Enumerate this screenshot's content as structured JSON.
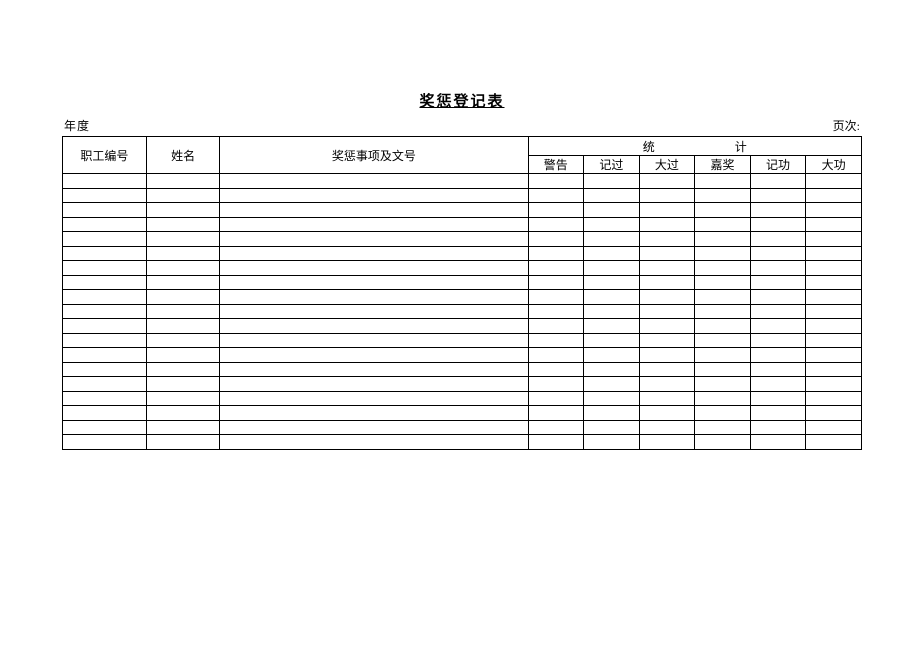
{
  "title": "奖惩登记表",
  "meta": {
    "year_label": "年度",
    "page_label": "页次:"
  },
  "headers": {
    "emp_id": "职工编号",
    "name": "姓名",
    "reward_item": "奖惩事项及文号",
    "stats_group": "统计",
    "sub": {
      "warn": "警告",
      "demerit": "记过",
      "major_demerit": "大过",
      "commend": "嘉奖",
      "minor_merit": "记功",
      "major_merit": "大功"
    }
  },
  "rows": [
    {
      "emp_id": "",
      "name": "",
      "item": "",
      "warn": "",
      "demerit": "",
      "major_demerit": "",
      "commend": "",
      "minor_merit": "",
      "major_merit": ""
    },
    {
      "emp_id": "",
      "name": "",
      "item": "",
      "warn": "",
      "demerit": "",
      "major_demerit": "",
      "commend": "",
      "minor_merit": "",
      "major_merit": ""
    },
    {
      "emp_id": "",
      "name": "",
      "item": "",
      "warn": "",
      "demerit": "",
      "major_demerit": "",
      "commend": "",
      "minor_merit": "",
      "major_merit": ""
    },
    {
      "emp_id": "",
      "name": "",
      "item": "",
      "warn": "",
      "demerit": "",
      "major_demerit": "",
      "commend": "",
      "minor_merit": "",
      "major_merit": ""
    },
    {
      "emp_id": "",
      "name": "",
      "item": "",
      "warn": "",
      "demerit": "",
      "major_demerit": "",
      "commend": "",
      "minor_merit": "",
      "major_merit": ""
    },
    {
      "emp_id": "",
      "name": "",
      "item": "",
      "warn": "",
      "demerit": "",
      "major_demerit": "",
      "commend": "",
      "minor_merit": "",
      "major_merit": ""
    },
    {
      "emp_id": "",
      "name": "",
      "item": "",
      "warn": "",
      "demerit": "",
      "major_demerit": "",
      "commend": "",
      "minor_merit": "",
      "major_merit": ""
    },
    {
      "emp_id": "",
      "name": "",
      "item": "",
      "warn": "",
      "demerit": "",
      "major_demerit": "",
      "commend": "",
      "minor_merit": "",
      "major_merit": ""
    },
    {
      "emp_id": "",
      "name": "",
      "item": "",
      "warn": "",
      "demerit": "",
      "major_demerit": "",
      "commend": "",
      "minor_merit": "",
      "major_merit": ""
    },
    {
      "emp_id": "",
      "name": "",
      "item": "",
      "warn": "",
      "demerit": "",
      "major_demerit": "",
      "commend": "",
      "minor_merit": "",
      "major_merit": ""
    },
    {
      "emp_id": "",
      "name": "",
      "item": "",
      "warn": "",
      "demerit": "",
      "major_demerit": "",
      "commend": "",
      "minor_merit": "",
      "major_merit": ""
    },
    {
      "emp_id": "",
      "name": "",
      "item": "",
      "warn": "",
      "demerit": "",
      "major_demerit": "",
      "commend": "",
      "minor_merit": "",
      "major_merit": ""
    },
    {
      "emp_id": "",
      "name": "",
      "item": "",
      "warn": "",
      "demerit": "",
      "major_demerit": "",
      "commend": "",
      "minor_merit": "",
      "major_merit": ""
    },
    {
      "emp_id": "",
      "name": "",
      "item": "",
      "warn": "",
      "demerit": "",
      "major_demerit": "",
      "commend": "",
      "minor_merit": "",
      "major_merit": ""
    },
    {
      "emp_id": "",
      "name": "",
      "item": "",
      "warn": "",
      "demerit": "",
      "major_demerit": "",
      "commend": "",
      "minor_merit": "",
      "major_merit": ""
    },
    {
      "emp_id": "",
      "name": "",
      "item": "",
      "warn": "",
      "demerit": "",
      "major_demerit": "",
      "commend": "",
      "minor_merit": "",
      "major_merit": ""
    },
    {
      "emp_id": "",
      "name": "",
      "item": "",
      "warn": "",
      "demerit": "",
      "major_demerit": "",
      "commend": "",
      "minor_merit": "",
      "major_merit": ""
    },
    {
      "emp_id": "",
      "name": "",
      "item": "",
      "warn": "",
      "demerit": "",
      "major_demerit": "",
      "commend": "",
      "minor_merit": "",
      "major_merit": ""
    },
    {
      "emp_id": "",
      "name": "",
      "item": "",
      "warn": "",
      "demerit": "",
      "major_demerit": "",
      "commend": "",
      "minor_merit": "",
      "major_merit": ""
    }
  ]
}
